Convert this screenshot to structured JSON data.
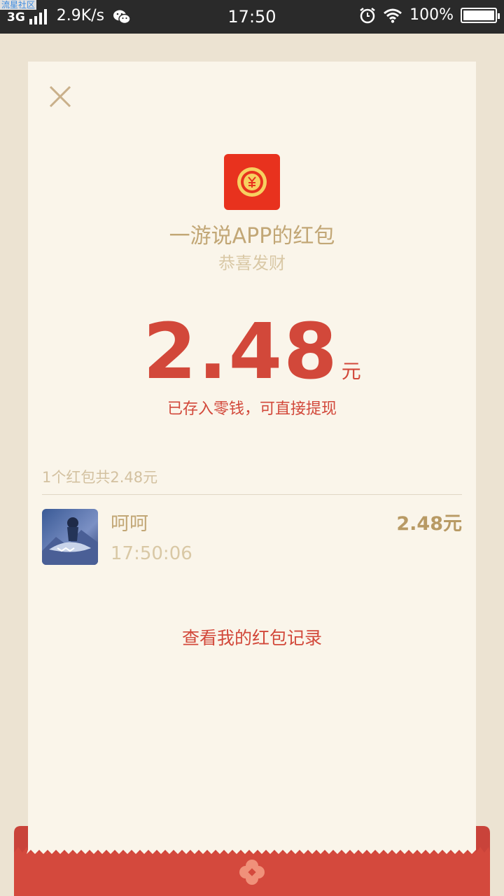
{
  "watermark": "流星社区",
  "status_bar": {
    "network": "3G",
    "speed": "2.9K/s",
    "time": "17:50",
    "battery": "100%",
    "battery_level": 1.0,
    "icons": [
      "signal-icon",
      "wechat-icon",
      "alarm-icon",
      "wifi-icon",
      "battery-icon"
    ]
  },
  "card": {
    "sender_name": "一游说APP的红包",
    "greeting": "恭喜发财",
    "amount": "2.48",
    "unit": "元",
    "deposit_note": "已存入零钱，可直接提现",
    "summary": "1个红包共2.48元",
    "records": [
      {
        "name": "呵呵",
        "time": "17:50:06",
        "amount": "2.48元"
      }
    ],
    "history_link": "查看我的红包记录"
  },
  "colors": {
    "accent_red": "#d2483a",
    "gold_text": "#c2a776",
    "card_bg": "#faf5ea",
    "page_bg": "#ece3d2"
  }
}
